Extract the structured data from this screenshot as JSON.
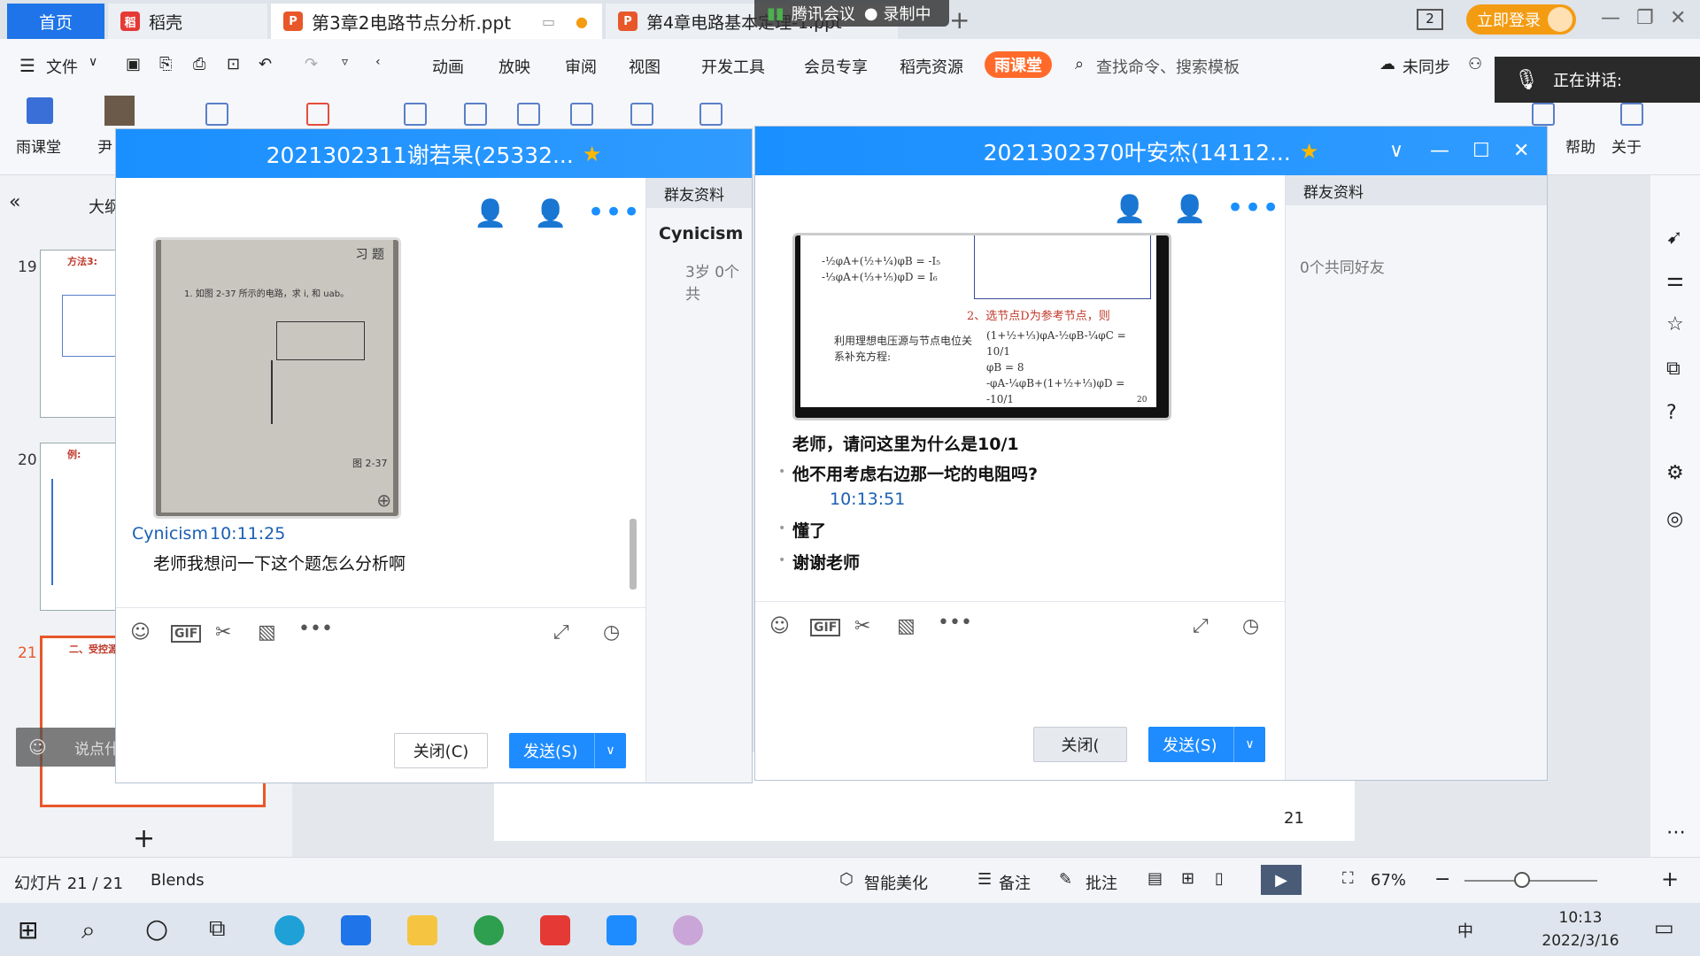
{
  "titlebar": {
    "tabs": [
      {
        "label": "首页"
      },
      {
        "label": "稻壳"
      },
      {
        "label": "第3章2电路节点分析.ppt"
      },
      {
        "label": "第4章电路基本定理-1.ppt"
      }
    ],
    "meeting_label": "腾讯会议",
    "recording_label": "录制中",
    "page_badge": "2",
    "login_label": "立即登录"
  },
  "menu": {
    "file_label": "文件",
    "items": [
      "动画",
      "放映",
      "审阅",
      "视图",
      "开发工具",
      "会员专享",
      "稻壳资源"
    ],
    "yuketang": "雨课堂",
    "search_placeholder": "查找命令、搜索模板",
    "sync_label": "未同步",
    "speaking_label": "正在讲话:"
  },
  "ribbon": {
    "left_label": "雨课堂",
    "left_label2": "尹",
    "help_label": "帮助",
    "about_label": "关于"
  },
  "leftpane": {
    "outline_label": "大纲",
    "slides": [
      {
        "num": "19",
        "title": "方法3:"
      },
      {
        "num": "20",
        "title": "例:"
      },
      {
        "num": "21",
        "title": "二、受控源的处理"
      }
    ],
    "chat_placeholder": "说点什么..."
  },
  "slide": {
    "page_num": "21"
  },
  "chat1": {
    "title": "2021302311谢若杲(25332...",
    "side_header": "群友资料",
    "profile_name": "Cynicism",
    "profile_info": "3岁  0个共",
    "photo_text_title": "习  题",
    "photo_text_q": "1. 如图 2-37 所示的电路，求 i, 和 uab。",
    "photo_fig": "图 2-37",
    "sender": "Cynicism",
    "time": "10:11:25",
    "message": "老师我想问一下这个题怎么分析啊",
    "close_btn": "关闭(C)",
    "send_btn": "发送(S)"
  },
  "chat2": {
    "title": "2021302370叶安杰(14112...",
    "side_header": "群友资料",
    "mutual": "0个共同好友",
    "shot_text1": "2、选节点D为参考节点，则",
    "shot_text2": "利用理想电压源与节点电位关系补充方程:",
    "shot_page": "20",
    "messages": [
      "老师，请问这里为什么是10/1",
      "他不用考虑右边那一坨的电阻吗?"
    ],
    "time": "10:13:51",
    "messages2": [
      "懂了",
      "谢谢老师"
    ],
    "close_btn": "关闭(",
    "send_btn": "发送(S)"
  },
  "statusbar": {
    "slide_info": "幻灯片 21 / 21",
    "theme": "Blends",
    "beautify": "智能美化",
    "notes": "备注",
    "comment": "批注",
    "zoom": "67%"
  },
  "taskbar": {
    "time": "10:13",
    "date": "2022/3/16",
    "ime": "中"
  }
}
